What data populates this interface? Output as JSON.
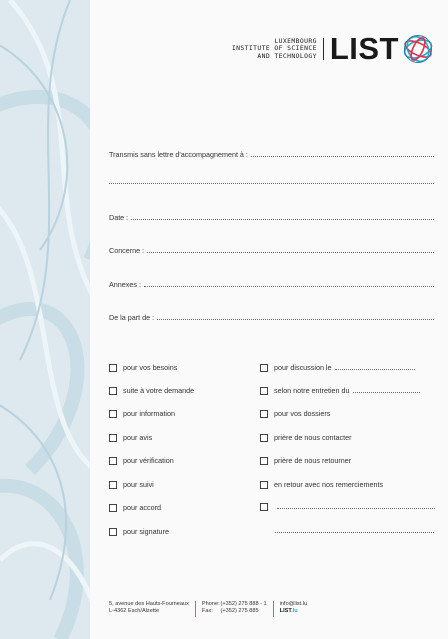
{
  "header": {
    "institute_lines": [
      "LUXEMBOURG",
      "INSTITUTE OF SCIENCE",
      "AND TECHNOLOGY"
    ],
    "logo_text": "LIST",
    "logo_icon": "list-sphere-logo-icon"
  },
  "fields": {
    "transmis": "Transmis sans lettre d'accompagnement à :",
    "date": "Date :",
    "concerne": "Concerne :",
    "annexes": "Annexes :",
    "de_la_part": "De la part de :"
  },
  "checkboxes_left": [
    "pour vos besoins",
    "suite à votre demande",
    "pour information",
    "pour avis",
    "pour vérification",
    "pour suivi",
    "pour accord",
    "pour signature"
  ],
  "checkboxes_right": [
    "pour discussion le",
    "selon notre entretien du",
    "pour vos dossiers",
    "prière de nous contacter",
    "prière de nous retourner",
    "en retour avec nos remerciements",
    ""
  ],
  "footer": {
    "address_line1": "5, avenue des Hauts-Fourneaux",
    "address_line2": "L-4362 Esch/Alzette",
    "phone_label": "Phone:",
    "phone": "(+352) 275 888 - 1",
    "fax_label": "Fax:",
    "fax": "(+352) 275 885",
    "email": "info@list.lu",
    "brand": "LIST",
    "brand_tld": ".lu"
  },
  "colors": {
    "band": "#dde9ef",
    "accent": "#2fa3c9",
    "logo_blue": "#2fa3c9",
    "logo_red": "#d9344a"
  }
}
